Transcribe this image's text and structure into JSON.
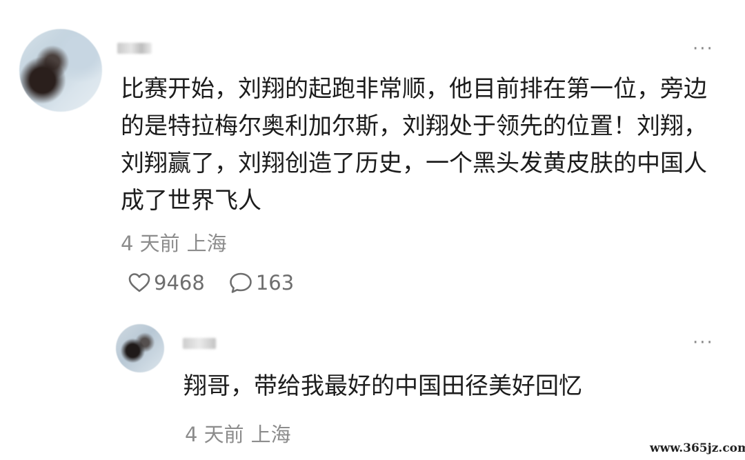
{
  "comment": {
    "body": "比赛开始，刘翔的起跑非常顺，他目前排在第一位，旁边的是特拉梅尔奥利加尔斯，刘翔处于领先的位置！刘翔，刘翔赢了，刘翔创造了历史，一个黑头发黄皮肤的中国人成了世界飞人",
    "more_label": "···",
    "time": "4 天前",
    "location": "上海",
    "likes": "9468",
    "replies_count": "163",
    "icons": {
      "like": "heart-outline-icon",
      "comment": "comment-bubble-icon",
      "more": "more-dots-icon"
    }
  },
  "reply": {
    "body": "翔哥，带给我最好的中国田径美好回忆",
    "more_label": "···",
    "time": "4 天前",
    "location": "上海"
  },
  "watermark": "www.365jz.com"
}
